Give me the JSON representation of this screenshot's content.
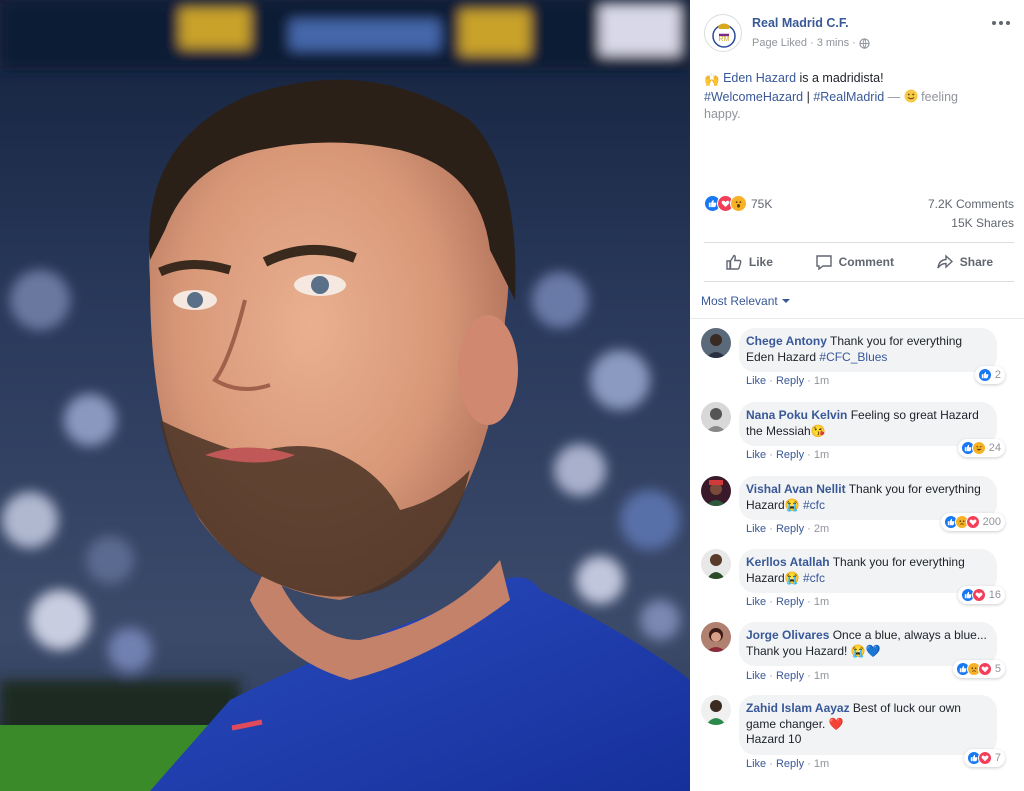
{
  "post": {
    "page_name": "Real Madrid C.F.",
    "page_liked": "Page Liked",
    "separator": " · ",
    "time": "3 mins",
    "text_emoji": "🙌",
    "mention": "Eden Hazard",
    "text_rest": " is a madridista!",
    "hashtag1": "#WelcomeHazard",
    "pipe": " | ",
    "hashtag2": "#RealMadrid",
    "dash": " — ",
    "feeling": "feeling",
    "feeling_word": "happy."
  },
  "stats": {
    "reactions": "75K",
    "comments": "7.2K Comments",
    "shares": "15K Shares"
  },
  "actions": {
    "like": "Like",
    "comment": "Comment",
    "share": "Share"
  },
  "sort_label": "Most Relevant",
  "comment_actions": {
    "like": "Like",
    "reply": "Reply",
    "dot": " · "
  },
  "comments": [
    {
      "name": "Chege Antony",
      "text": " Thank you for everything Eden Hazard ",
      "tag": "#CFC_Blues",
      "time": "1m",
      "count": "2"
    },
    {
      "name": "Nana Poku Kelvin",
      "text": " Feeling so great Hazard the Messiah",
      "emoji": "😘",
      "time": "1m",
      "count": "24"
    },
    {
      "name": "Vishal Avan Nellit",
      "text": " Thank you for everything Hazard",
      "emoji": "😭",
      "tag": " #cfc",
      "time": "2m",
      "count": "200"
    },
    {
      "name": "Kerllos Atallah",
      "text": " Thank you for everything Hazard",
      "emoji": "😭",
      "tag": " #cfc",
      "time": "1m",
      "count": "16"
    },
    {
      "name": "Jorge Olivares",
      "text": " Once a blue, always a blue... Thank you Hazard! ",
      "emoji": "😭💙",
      "time": "1m",
      "count": "5"
    },
    {
      "name": "Zahid Islam Aayaz",
      "text": " Best of luck our own game changer. ",
      "emoji": "❤️",
      "text2": "Hazard 10",
      "time": "1m",
      "count": "7"
    }
  ],
  "colors": {
    "link": "#385898",
    "like_blue": "#1877f2",
    "love_red": "#f33e58",
    "wow_yellow": "#f7b125",
    "shirt_blue": "#1f3fa8"
  }
}
